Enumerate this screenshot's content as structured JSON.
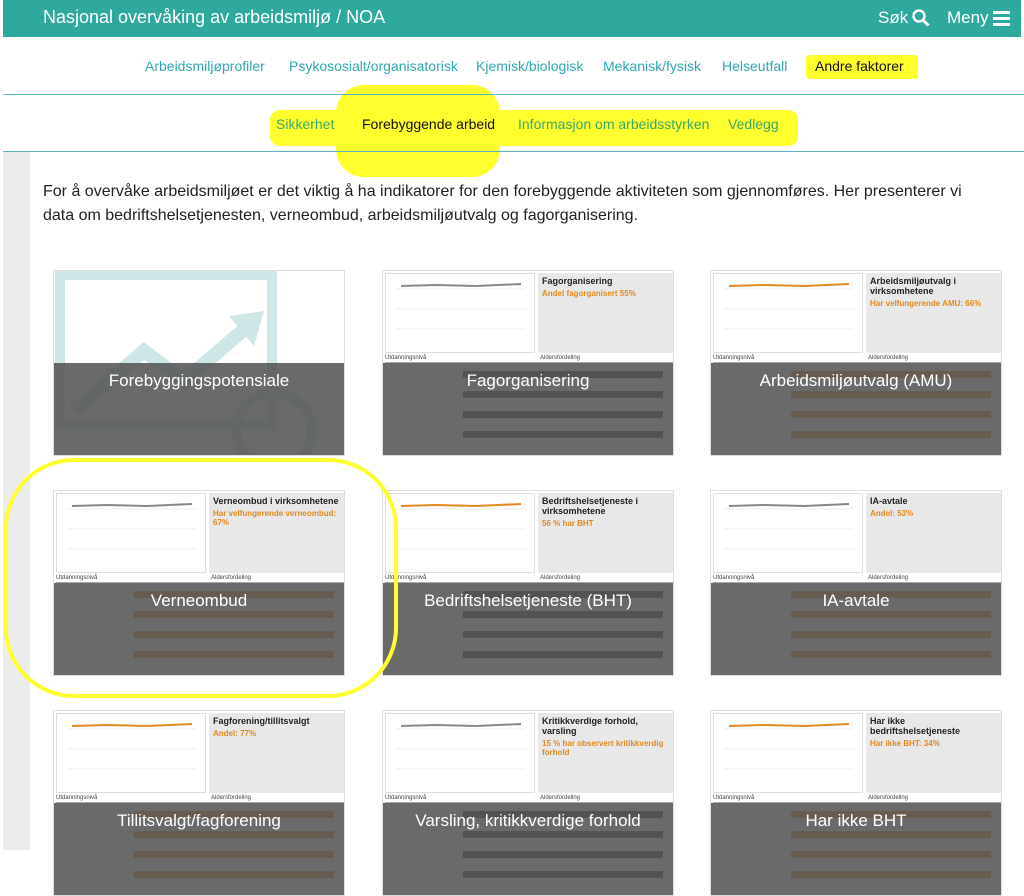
{
  "header": {
    "title": "Nasjonal overvåking av arbeidsmiljø / NOA",
    "search_label": "Søk",
    "menu_label": "Meny"
  },
  "nav_primary": [
    "Arbeidsmiljøprofiler",
    "Psykososialt/organisatorisk",
    "Kjemisk/biologisk",
    "Mekanisk/fysisk",
    "Helseutfall",
    "Andre faktorer"
  ],
  "nav_secondary": [
    "Sikkerhet",
    "Forebyggende arbeid",
    "Informasjon om arbeidsstyrken",
    "Vedlegg"
  ],
  "intro": "For å overvåke arbeidsmiljøet er det viktig å ha indikatorer for den forebyggende aktiviteten som gjennomføres. Her presenterer vi data om bedriftshelsetjenesten, verneombud, arbeidsmiljøutvalg og fagorganisering.",
  "cards": [
    {
      "label": "Forebyggingspotensiale",
      "thumb_title": "",
      "thumb_value": ""
    },
    {
      "label": "Fagorganisering",
      "thumb_title": "Fagorganisering",
      "thumb_value": "Andel fagorganisert 55%"
    },
    {
      "label": "Arbeidsmiljøutvalg (AMU)",
      "thumb_title": "Arbeidsmiljøutvalg i virksomhetene",
      "thumb_value": "Har velfungerende AMU: 66%"
    },
    {
      "label": "Verneombud",
      "thumb_title": "Verneombud i virksomhetene",
      "thumb_value": "Har velfungerende verneombud: 67%"
    },
    {
      "label": "Bedriftshelsetjeneste (BHT)",
      "thumb_title": "Bedriftshelsetjeneste i virksomhetene",
      "thumb_value": "56 % har BHT"
    },
    {
      "label": "IA-avtale",
      "thumb_title": "IA-avtale",
      "thumb_value": "Andel: 53%"
    },
    {
      "label": "Tillitsvalgt/fagforening",
      "thumb_title": "Fagforening/tillitsvalgt",
      "thumb_value": "Andel: 77%"
    },
    {
      "label": "Varsling, kritikkverdige forhold",
      "thumb_title": "Kritikkverdige forhold, varsling",
      "thumb_value": "15 % har observert kritikkverdig forhold"
    },
    {
      "label": "Har ikke BHT",
      "thumb_title": "Har ikke bedriftshelsetjeneste",
      "thumb_value": "Har ikke BHT: 34%"
    }
  ],
  "thumb_strip_left": "Utdanningsnivå",
  "thumb_strip_right": "Aldersfordeling",
  "colors": {
    "teal": "#2fa89e",
    "link": "#2fa8b2",
    "highlight": "#ffff2e",
    "orange": "#e08a20"
  }
}
